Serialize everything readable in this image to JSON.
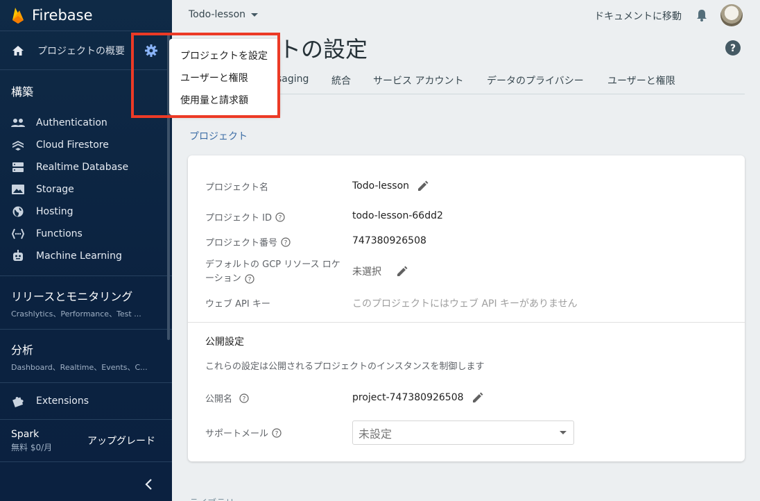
{
  "app": {
    "name": "Firebase"
  },
  "sidebar": {
    "overview_label": "プロジェクトの概要",
    "build_heading": "構築",
    "items": [
      {
        "label": "Authentication",
        "icon": "people-icon"
      },
      {
        "label": "Cloud Firestore",
        "icon": "firestore-icon"
      },
      {
        "label": "Realtime Database",
        "icon": "database-icon"
      },
      {
        "label": "Storage",
        "icon": "image-icon"
      },
      {
        "label": "Hosting",
        "icon": "globe-icon"
      },
      {
        "label": "Functions",
        "icon": "functions-icon"
      },
      {
        "label": "Machine Learning",
        "icon": "robot-icon"
      }
    ],
    "release": {
      "title": "リリースとモニタリング",
      "subtitle": "Crashlytics、Performance、Test ..."
    },
    "analytics": {
      "title": "分析",
      "subtitle": "Dashboard、Realtime、Events、C..."
    },
    "extensions_label": "Extensions",
    "plan": {
      "name": "Spark",
      "price": "無料 $0/月",
      "upgrade_label": "アップグレード"
    }
  },
  "header": {
    "project_name": "Todo-lesson",
    "docs_link": "ドキュメントに移動"
  },
  "page": {
    "title": "プロジェクトの設定",
    "title_visible": "クトの設定",
    "tabs": [
      "saging",
      "統合",
      "サービス アカウント",
      "データのプライバシー",
      "ユーザーと権限"
    ]
  },
  "settings_menu": {
    "items": [
      "プロジェクトを設定",
      "ユーザーと権限",
      "使用量と請求額"
    ]
  },
  "project_section": {
    "label": "プロジェクト",
    "rows": {
      "name": {
        "label": "プロジェクト名",
        "value": "Todo-lesson"
      },
      "id": {
        "label": "プロジェクト ID",
        "value": "todo-lesson-66dd2"
      },
      "number": {
        "label": "プロジェクト番号",
        "value": "747380926508"
      },
      "gcp_location": {
        "label_line1": "デフォルトの GCP リソース ロケ",
        "label_line2": "ーション",
        "value": "未選択"
      },
      "web_api_key": {
        "label": "ウェブ API キー",
        "value": "このプロジェクトにはウェブ API キーがありません"
      }
    }
  },
  "public_settings": {
    "title": "公開設定",
    "description": "これらの設定は公開されるプロジェクトのインスタンスを制御します",
    "public_name": {
      "label": "公開名",
      "value": "project-747380926508"
    },
    "support_email": {
      "label": "サポートメール",
      "selected": "未設定"
    }
  },
  "bottom_stub": "ライブラリ",
  "colors": {
    "sidebar_bg": "#0f2a46",
    "accent_blue": "#3e6ea6",
    "highlight_red": "#ec3a26",
    "gear_blue": "#8ab4f8"
  }
}
